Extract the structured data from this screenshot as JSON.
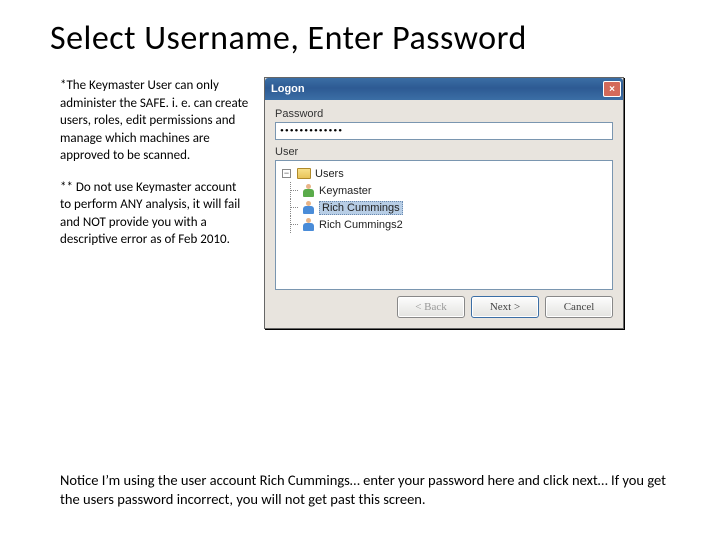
{
  "title": "Select Username, Enter Password",
  "para1": "*The Keymaster User can only administer the SAFE. i. e. can create users, roles, edit permissions and manage which machines are approved to be scanned.",
  "para2": "** Do not use Keymaster account to perform ANY analysis, it will fail and NOT provide you with a descriptive error as of Feb 2010.",
  "bottom": "Notice I’m using the user account Rich Cummings… enter your password here and click next…  If you get the users password incorrect, you will not get past this screen.",
  "dialog": {
    "title": "Logon",
    "password_label": "Password",
    "password_value": "•••••••••••••",
    "user_label": "User",
    "tree": {
      "root_expander": "−",
      "root": "Users",
      "items": [
        "Keymaster",
        "Rich Cummings",
        "Rich Cummings2"
      ],
      "selected_index": 1
    },
    "buttons": {
      "back": "< Back",
      "next": "Next >",
      "cancel": "Cancel"
    }
  }
}
